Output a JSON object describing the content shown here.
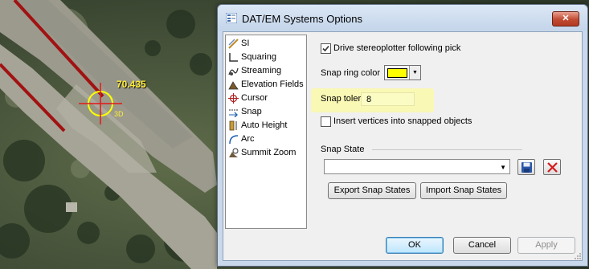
{
  "map": {
    "elevation_value": "70.435",
    "cursor_mode": "3D"
  },
  "dialog": {
    "title": "DAT/EM Systems Options",
    "close_label": "✕",
    "nav_items": [
      {
        "label": "SI",
        "icon": "si-icon"
      },
      {
        "label": "Squaring",
        "icon": "squaring-icon"
      },
      {
        "label": "Streaming",
        "icon": "streaming-icon"
      },
      {
        "label": "Elevation Fields",
        "icon": "elevation-fields-icon"
      },
      {
        "label": "Cursor",
        "icon": "cursor-crosshair-icon"
      },
      {
        "label": "Snap",
        "icon": "snap-icon"
      },
      {
        "label": "Auto Height",
        "icon": "auto-height-icon"
      },
      {
        "label": "Arc",
        "icon": "arc-icon"
      },
      {
        "label": "Summit Zoom",
        "icon": "summit-zoom-icon"
      }
    ],
    "snap": {
      "drive_stereoplotter_label": "Drive stereoplotter following pick",
      "drive_stereoplotter_checked": true,
      "ring_color_label": "Snap ring color",
      "ring_color": "#ffff00",
      "tolerance_label": "Snap tolerance",
      "tolerance_value": "8",
      "insert_vertices_label": "Insert vertices into snapped objects",
      "insert_vertices_checked": false,
      "state_group_label": "Snap State",
      "state_selected": "",
      "export_label": "Export Snap States",
      "import_label": "Import Snap States"
    },
    "buttons": {
      "ok": "OK",
      "cancel": "Cancel",
      "apply": "Apply"
    }
  }
}
